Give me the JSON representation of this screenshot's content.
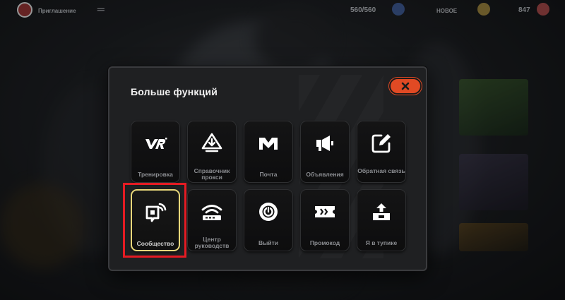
{
  "colors": {
    "accent_orange": "#e14a24",
    "selected_border": "#e8d77a",
    "highlight_red": "#e51b23"
  },
  "background": {
    "top_left_text": "Приглашение",
    "top_right_counter": "560/560",
    "top_right_badge": "НОВОЕ",
    "top_right_amount": "847"
  },
  "dialog": {
    "title": "Больше функций",
    "close_icon": "close-x-icon",
    "tiles": [
      {
        "label": "Тренировка",
        "icon": "vr-logo-icon"
      },
      {
        "label": "Справочник прокси",
        "icon": "proxy-handbook-icon"
      },
      {
        "label": "Почта",
        "icon": "mail-icon"
      },
      {
        "label": "Объявления",
        "icon": "megaphone-icon"
      },
      {
        "label": "Обратная связь",
        "icon": "feedback-edit-icon"
      },
      {
        "label": "Сообщество",
        "icon": "community-icon",
        "selected": true
      },
      {
        "label": "Центр руководств",
        "icon": "guide-center-icon"
      },
      {
        "label": "Выйти",
        "icon": "power-icon"
      },
      {
        "label": "Промокод",
        "icon": "promo-ticket-icon"
      },
      {
        "label": "Я в тупике",
        "icon": "stuck-upload-icon"
      }
    ]
  }
}
